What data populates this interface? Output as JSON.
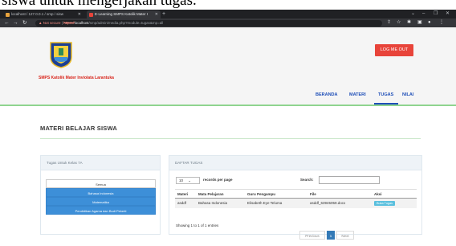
{
  "caption": {
    "text": "siswa untuk mengerjakan tugas."
  },
  "browser": {
    "tabs": [
      {
        "label": "localhost / 127.0.0.1 / smp / sisw",
        "color": "#e8a33d"
      },
      {
        "label": "E-Learning SMPS Katolik Mater I",
        "color": "#e8443a"
      }
    ],
    "new_tab": "+",
    "url_warning": "Not secure",
    "url_scheme": "https://",
    "url_host": "localhost",
    "url_path": "/smp/admin/media.php?module=tugas&mp=all"
  },
  "header": {
    "school_name": "SMPS Katolik Mater Inviolata Larantuka",
    "logout_label": "LOG ME OUT"
  },
  "nav": {
    "beranda": "BERANDA",
    "materi": "MATERI",
    "tugas": "TUGAS",
    "nilai": "NILAI"
  },
  "page": {
    "title": "MATERI BELAJAR SISWA"
  },
  "left_panel": {
    "title": "Tugas Untuk Kelas 7A",
    "all_label": "Semua",
    "subjects": [
      "Bahasa Indonesia",
      "Matematika",
      "Pendidikan Agama dan Budi Pekerti"
    ]
  },
  "right_panel": {
    "title": "DAFTAR TUGAS",
    "length_value": "10",
    "length_text": "records per page",
    "search_label": "Search:",
    "columns": [
      "Materi",
      "Mata Pelajaran",
      "Guru Pengampu",
      "File",
      "Aksi"
    ],
    "rows": [
      {
        "materi": "asddf",
        "mapel": "Bahasa Indonesia",
        "guru": "Elisabeth Eye Teluma",
        "file": "asddf_63945059.docx",
        "aksi": "Buka Tugas"
      }
    ],
    "info": "Showing 1 to 1 of 1 entries",
    "prev": "Previous",
    "page": "1",
    "next": "Next"
  },
  "colors": {
    "accent_red": "#e8443a",
    "nav_blue": "#1f4fb8",
    "subject_blue": "#3d8fd8",
    "green_line": "#8fd48f"
  }
}
